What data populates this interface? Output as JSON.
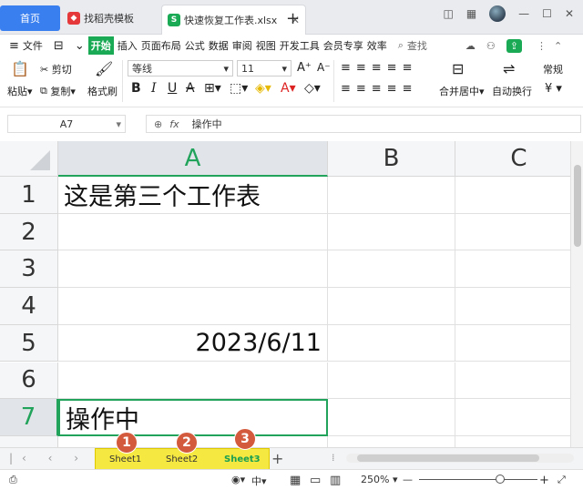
{
  "tabs": {
    "home": "首页",
    "store": "找稻壳模板",
    "doc": "快速恢复工作表.xlsx",
    "doc_icon": "S"
  },
  "menu": {
    "file": "文件",
    "items": [
      "开始",
      "插入",
      "页面布局",
      "公式",
      "数据",
      "审阅",
      "视图",
      "开发工具",
      "会员专享",
      "效率"
    ],
    "search": "查找"
  },
  "ribbon": {
    "paste": "粘贴",
    "cut": "剪切",
    "copy": "复制",
    "format_painter": "格式刷",
    "font_name": "等线",
    "font_size": "11",
    "merge": "合并居中",
    "wrap": "自动换行",
    "number_format": "常规",
    "currency": "¥"
  },
  "formula": {
    "name_box": "A7",
    "fx": "fx",
    "content": "操作中"
  },
  "columns": [
    "A",
    "B",
    "C"
  ],
  "rows": [
    "1",
    "2",
    "3",
    "4",
    "5",
    "6",
    "7"
  ],
  "cells": {
    "A1": "这是第三个工作表",
    "A5": "2023/6/11",
    "A7": "操作中"
  },
  "sheets": [
    "Sheet1",
    "Sheet2",
    "Sheet3"
  ],
  "badges": [
    "1",
    "2",
    "3"
  ],
  "status": {
    "zoom": "250%"
  },
  "colors": {
    "accent": "#22a35c",
    "badge": "#d35a3c",
    "highlight": "#f5e840",
    "home_tab": "#3a7ff0"
  }
}
